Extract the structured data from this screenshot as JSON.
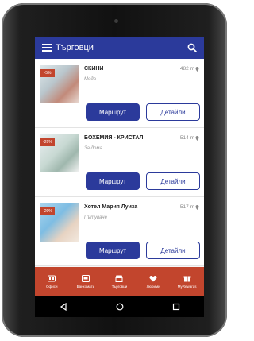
{
  "app_title": "Търговци",
  "stores": [
    {
      "name": "СКИНИ",
      "category": "Мода",
      "distance": "482 m",
      "discount": "-5%",
      "route_label": "Маршрут",
      "details_label": "Детайли"
    },
    {
      "name": "БОХЕМИЯ - КРИСТАЛ",
      "category": "За дома",
      "distance": "514 m",
      "discount": "-20%",
      "route_label": "Маршрут",
      "details_label": "Детайли"
    },
    {
      "name": "Хотел Мария Луиза",
      "category": "Пътуване",
      "distance": "517 m",
      "discount": "-20%",
      "route_label": "Маршрут",
      "details_label": "Детайли"
    }
  ],
  "bottom_nav": [
    {
      "label": "Офиси",
      "icon": "office-icon"
    },
    {
      "label": "Банкомати",
      "icon": "atm-icon"
    },
    {
      "label": "Търговци",
      "icon": "store-icon"
    },
    {
      "label": "Любими",
      "icon": "heart-icon"
    },
    {
      "label": "MyRewards",
      "icon": "gift-icon"
    }
  ],
  "colors": {
    "primary": "#2b3a9b",
    "accent": "#c2452d",
    "background": "#f6f6f6"
  }
}
